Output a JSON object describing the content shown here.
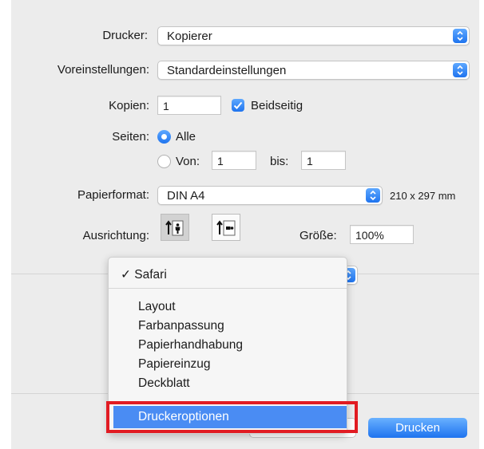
{
  "form": {
    "printer_label": "Drucker:",
    "printer_value": "Kopierer",
    "presets_label": "Voreinstellungen:",
    "presets_value": "Standardeinstellungen",
    "copies_label": "Kopien:",
    "copies_value": "1",
    "duplex_label": "Beidseitig",
    "duplex_checked": true,
    "pages_label": "Seiten:",
    "pages_all_label": "Alle",
    "pages_from_label": "Von:",
    "pages_from_value": "1",
    "pages_to_label": "bis:",
    "pages_to_value": "1",
    "paper_label": "Papierformat:",
    "paper_value": "DIN A4",
    "paper_size": "210 x 297 mm",
    "orientation_label": "Ausrichtung:",
    "scale_label": "Größe:",
    "scale_value": "100%"
  },
  "menu": {
    "checked_item": "Safari",
    "items": [
      "Layout",
      "Farbanpassung",
      "Papierhandhabung",
      "Papiereinzug",
      "Deckblatt"
    ],
    "highlighted_item": "Druckeroptionen"
  },
  "buttons": {
    "print_label": "Drucken"
  },
  "colors": {
    "accent": "#1f74ef",
    "highlight": "#4a8cf3",
    "annotation": "#e11b22"
  }
}
